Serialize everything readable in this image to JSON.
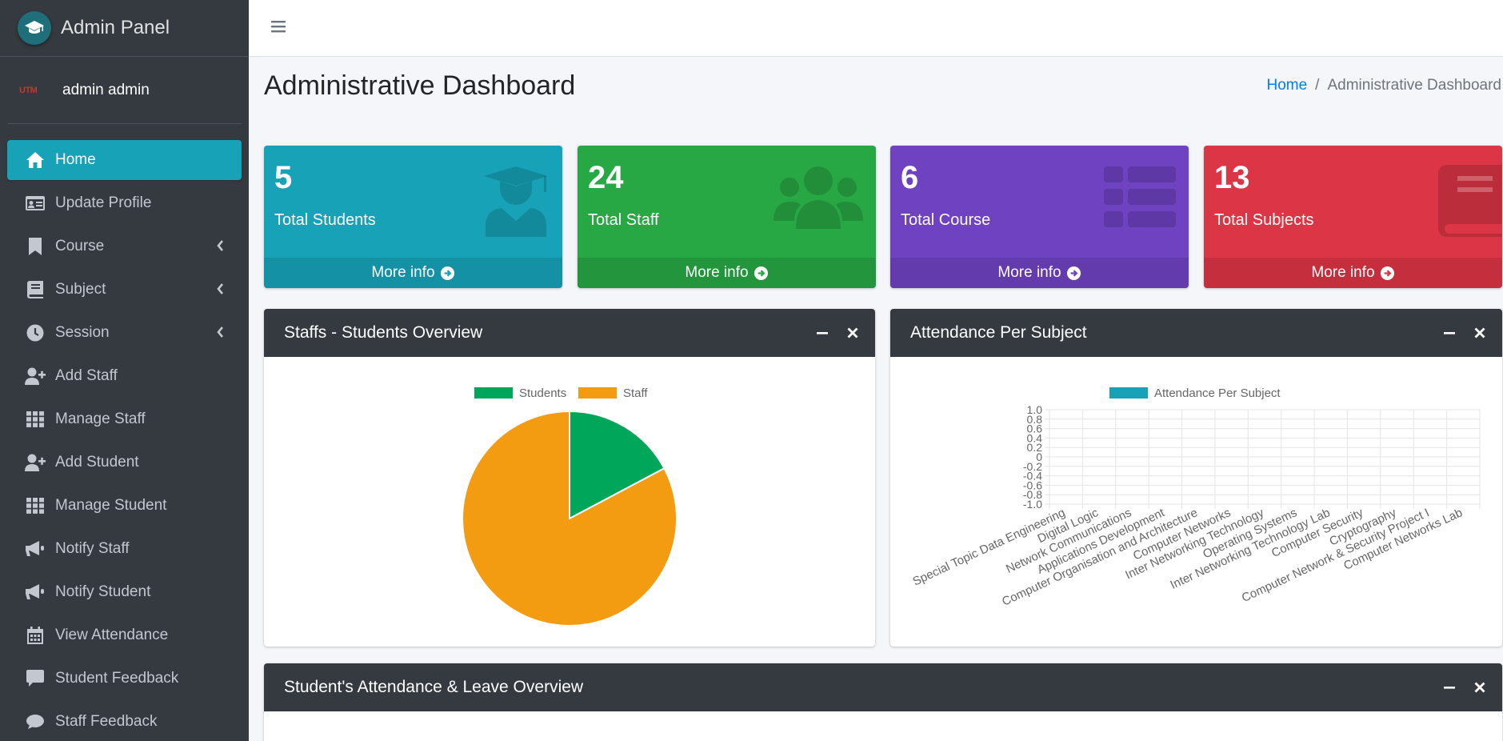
{
  "brand": {
    "title": "Admin Panel"
  },
  "user": {
    "name": "admin admin",
    "logo_text": "UTM"
  },
  "sidebar": {
    "items": [
      {
        "label": "Home",
        "icon": "home-icon",
        "active": true
      },
      {
        "label": "Update Profile",
        "icon": "id-card-icon"
      },
      {
        "label": "Course",
        "icon": "bookmark-icon",
        "arrow": true
      },
      {
        "label": "Subject",
        "icon": "book-icon",
        "arrow": true
      },
      {
        "label": "Session",
        "icon": "clock-icon",
        "arrow": true
      },
      {
        "label": "Add Staff",
        "icon": "user-plus-icon"
      },
      {
        "label": "Manage Staff",
        "icon": "grid-icon"
      },
      {
        "label": "Add Student",
        "icon": "user-plus-icon"
      },
      {
        "label": "Manage Student",
        "icon": "grid-icon"
      },
      {
        "label": "Notify Staff",
        "icon": "megaphone-icon"
      },
      {
        "label": "Notify Student",
        "icon": "megaphone-icon"
      },
      {
        "label": "View Attendance",
        "icon": "calendar-icon"
      },
      {
        "label": "Student Feedback",
        "icon": "comment-square-icon"
      },
      {
        "label": "Staff Feedback",
        "icon": "comment-icon"
      }
    ]
  },
  "header": {
    "title": "Administrative Dashboard",
    "breadcrumb": {
      "home": "Home",
      "separator": "/",
      "current": "Administrative Dashboard"
    }
  },
  "stats": [
    {
      "value": "5",
      "label": "Total Students",
      "more": "More info",
      "color": "#17a2b8",
      "icon": "graduate-icon"
    },
    {
      "value": "24",
      "label": "Total Staff",
      "more": "More info",
      "color": "#28a745",
      "icon": "users-icon"
    },
    {
      "value": "6",
      "label": "Total Course",
      "more": "More info",
      "color": "#6f42c1",
      "icon": "list-icon"
    },
    {
      "value": "13",
      "label": "Total Subjects",
      "more": "More info",
      "color": "#dc3545",
      "icon": "book-icon"
    }
  ],
  "cards": {
    "overview": {
      "title": "Staffs - Students Overview"
    },
    "attendance": {
      "title": "Attendance Per Subject"
    },
    "leave": {
      "title": "Student's Attendance & Leave Overview"
    }
  },
  "chart_data": [
    {
      "type": "pie",
      "categories": [
        "Students",
        "Staff"
      ],
      "values": [
        5,
        24
      ],
      "colors": [
        "#00a65a",
        "#f39c12"
      ],
      "legend": "top"
    },
    {
      "type": "bar",
      "categories": [
        "Special Topic Data Engineering",
        "Digital Logic",
        "Network Communications",
        "Applications Development",
        "Computer Organisation and Architecture",
        "Computer Networks",
        "Inter Networking Technology",
        "Operating Systems",
        "Inter Networking Technology Lab",
        "Computer Security",
        "Cryptography",
        "Computer Network & Security Project I",
        "Computer Networks Lab"
      ],
      "series": [
        {
          "name": "Attendance Per Subject",
          "values": [
            0,
            0,
            0,
            0,
            0,
            0,
            0,
            0,
            0,
            0,
            0,
            0,
            0
          ],
          "color": "#17a2b8"
        }
      ],
      "yticks": [
        "1.0",
        "0.8",
        "0.6",
        "0.4",
        "0.2",
        "0",
        "-0.2",
        "-0.4",
        "-0.6",
        "-0.8",
        "-1.0"
      ],
      "ylim": [
        -1,
        1
      ],
      "grid": true,
      "legend": "top"
    }
  ]
}
